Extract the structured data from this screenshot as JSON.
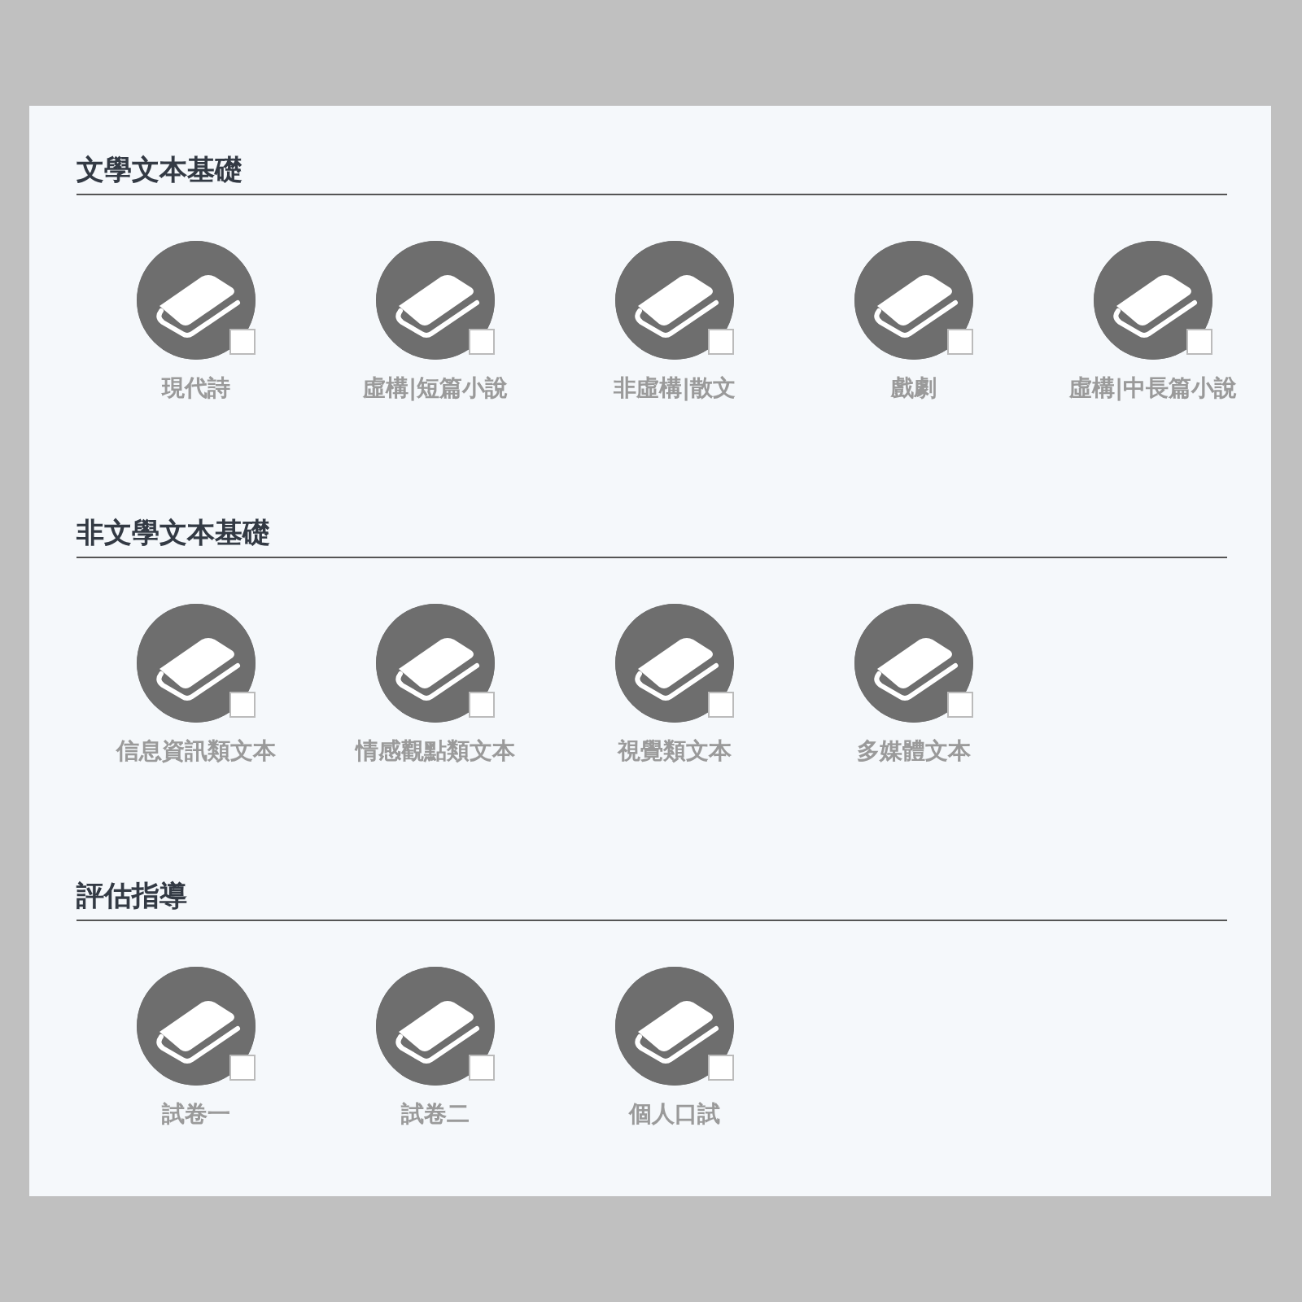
{
  "sections": [
    {
      "title": "文學文本基礎",
      "items": [
        {
          "label": "現代詩",
          "checked": false
        },
        {
          "label": "虛構|短篇小說",
          "checked": false
        },
        {
          "label": "非虛構|散文",
          "checked": false
        },
        {
          "label": "戲劇",
          "checked": false
        },
        {
          "label": "虛構|中長篇小說",
          "checked": false
        }
      ]
    },
    {
      "title": "非文學文本基礎",
      "items": [
        {
          "label": "信息資訊類文本",
          "checked": false
        },
        {
          "label": "情感觀點類文本",
          "checked": false
        },
        {
          "label": "視覺類文本",
          "checked": false
        },
        {
          "label": "多媒體文本",
          "checked": false
        }
      ]
    },
    {
      "title": "評估指導",
      "items": [
        {
          "label": "試卷一",
          "checked": false
        },
        {
          "label": "試卷二",
          "checked": false
        },
        {
          "label": "個人口試",
          "checked": false
        }
      ]
    }
  ]
}
